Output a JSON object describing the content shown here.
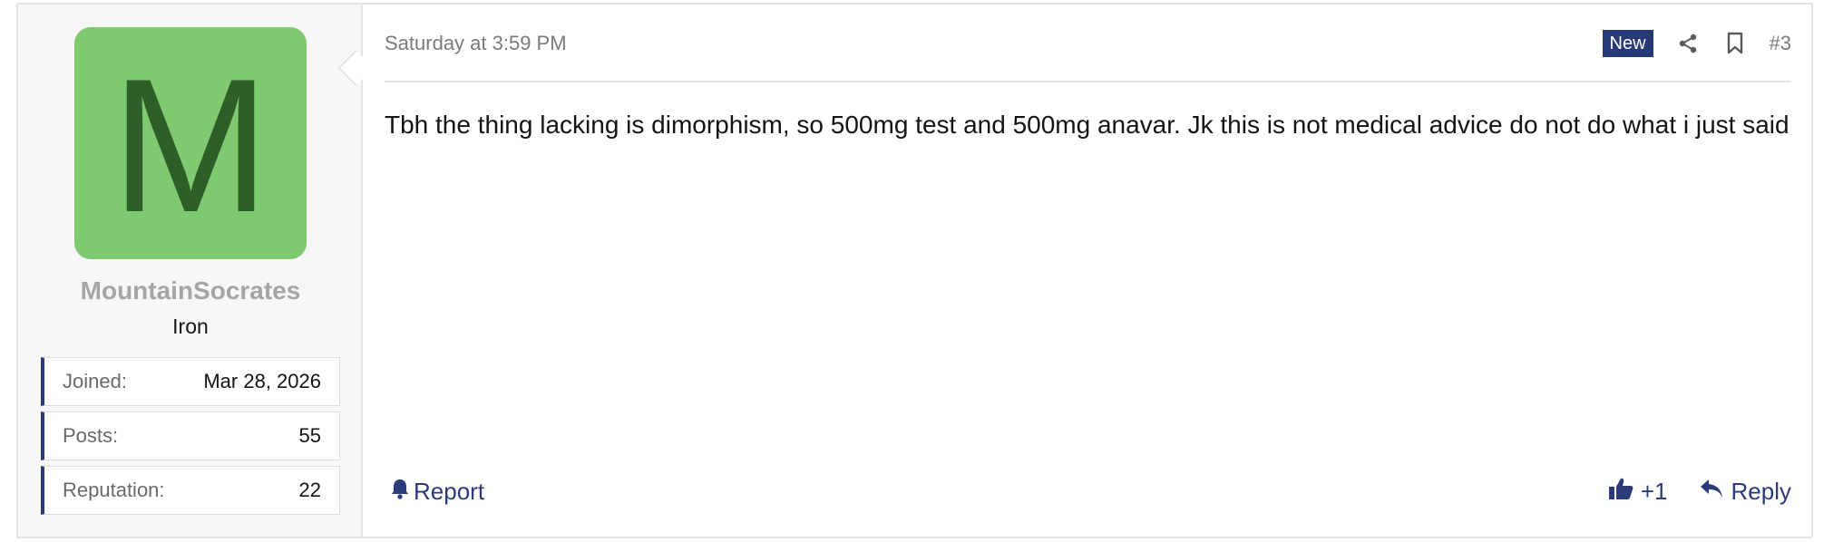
{
  "user": {
    "avatar_letter": "M",
    "avatar_color": "#7fc970",
    "username": "MountainSocrates",
    "title": "Iron",
    "stats": [
      {
        "label": "Joined:",
        "value": "Mar 28, 2026"
      },
      {
        "label": "Posts:",
        "value": "55"
      },
      {
        "label": "Reputation:",
        "value": "22"
      }
    ]
  },
  "post": {
    "date": "Saturday at 3:59 PM",
    "new_badge": "New",
    "number": "#3",
    "body": "Tbh the thing lacking is dimorphism, so 500mg test and 500mg anavar. Jk this is not medical advice do not do what i just said"
  },
  "actions": {
    "report_label": "Report",
    "like_count": "+1",
    "reply_label": "Reply"
  },
  "icons": {
    "share": "share-icon",
    "bookmark": "bookmark-icon",
    "report": "bell-icon",
    "like": "thumbs-up-icon",
    "reply": "reply-icon"
  },
  "colors": {
    "accent": "#2a3a7a",
    "badge": "#263a78"
  }
}
